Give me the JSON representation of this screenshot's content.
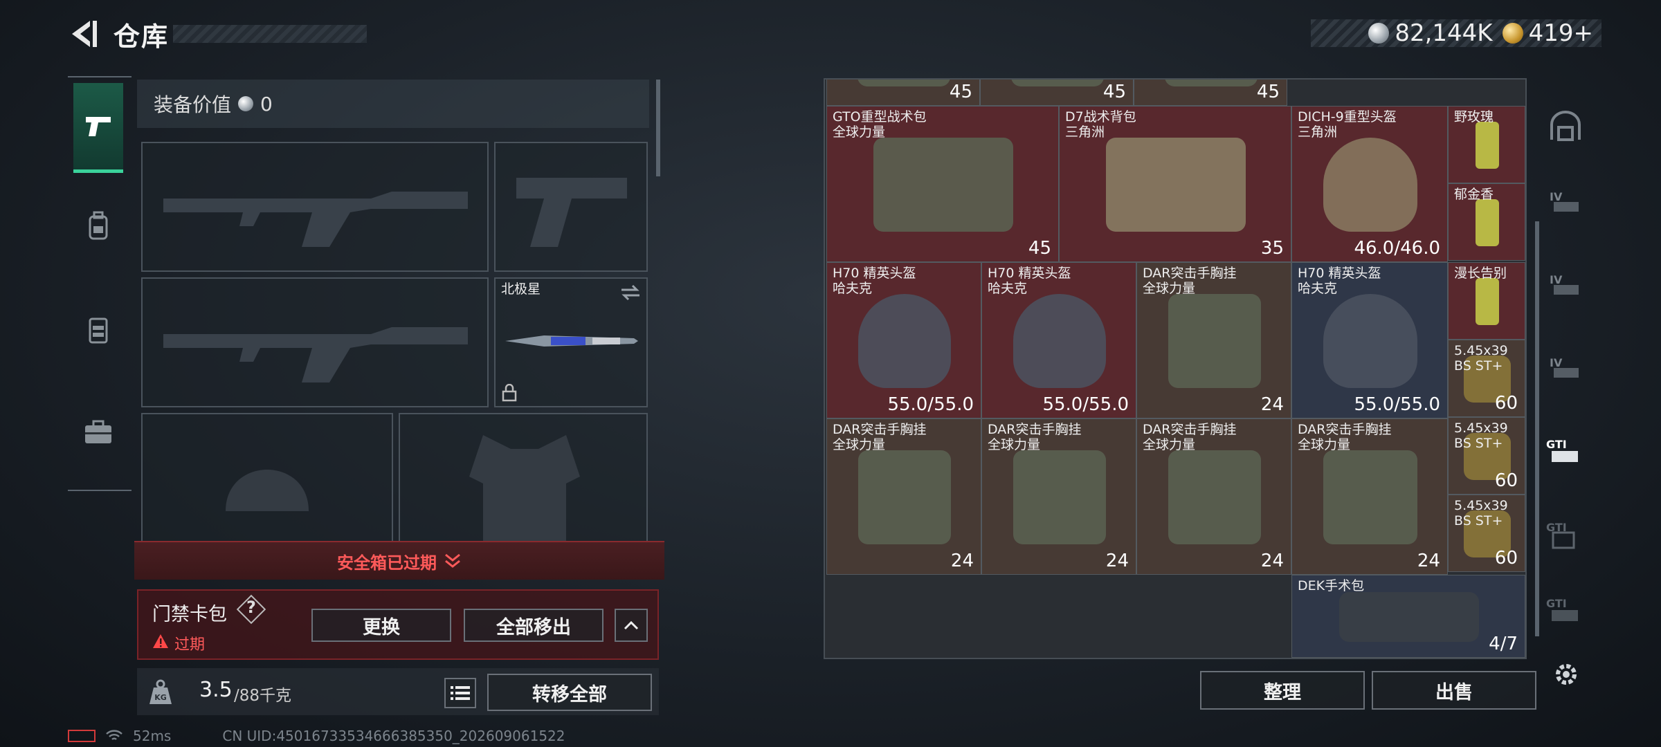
{
  "header": {
    "title": "仓库"
  },
  "currency": {
    "silver": "82,144K",
    "gold": "419+"
  },
  "loadout": {
    "equip_value_label": "装备价值",
    "equip_value": "0",
    "melee_name": "北极星"
  },
  "safebox": {
    "label": "安全箱已过期"
  },
  "keybag": {
    "label": "门禁卡包",
    "help": "?",
    "status": "过期",
    "replace": "更换",
    "remove_all": "全部移出"
  },
  "weight": {
    "value": "3.5",
    "capacity": "/88千克",
    "transfer_all": "转移全部"
  },
  "stash": {
    "items": [
      {
        "name": "",
        "sub": "",
        "count": "45"
      },
      {
        "name": "",
        "sub": "",
        "count": "45"
      },
      {
        "name": "",
        "sub": "",
        "count": "45"
      },
      {
        "name": "GTO重型战术包",
        "sub": "全球力量",
        "count": "45"
      },
      {
        "name": "D7战术背包",
        "sub": "三角洲",
        "count": "35"
      },
      {
        "name": "DICH-9重型头盔",
        "sub": "三角洲",
        "count": "46.0/46.0"
      },
      {
        "name": "野玫瑰",
        "sub": "",
        "count": ""
      },
      {
        "name": "郁金香",
        "sub": "",
        "count": ""
      },
      {
        "name": "H70 精英头盔",
        "sub": "哈夫克",
        "count": "55.0/55.0"
      },
      {
        "name": "漫长告别",
        "sub": "",
        "count": ""
      },
      {
        "name": "H70 精英头盔",
        "sub": "哈夫克",
        "count": "55.0/55.0"
      },
      {
        "name": "H70 精英头盔",
        "sub": "哈夫克",
        "count": "55.0/55.0"
      },
      {
        "name": "DAR突击手胸挂",
        "sub": "全球力量",
        "count": "24"
      },
      {
        "name": "5.45x39",
        "sub": "BS ST+",
        "count": "60"
      },
      {
        "name": "DAR突击手胸挂",
        "sub": "全球力量",
        "count": "24"
      },
      {
        "name": "5.45x39",
        "sub": "BS ST+",
        "count": "60"
      },
      {
        "name": "DAR突击手胸挂",
        "sub": "全球力量",
        "count": "24"
      },
      {
        "name": "DAR突击手胸挂",
        "sub": "全球力量",
        "count": "24"
      },
      {
        "name": "DAR突击手胸挂",
        "sub": "全球力量",
        "count": "24"
      },
      {
        "name": "5.45x39",
        "sub": "BS ST+",
        "count": "60"
      },
      {
        "name": "DEK手术包",
        "sub": "",
        "count": "4/7"
      }
    ]
  },
  "actions": {
    "organize": "整理",
    "sell": "出售"
  },
  "status": {
    "ping": "52ms",
    "uid": "CN UID:45016733534666385350_202609061522"
  },
  "colors": {
    "accent": "#3ad29b",
    "alert": "#ff5a5a"
  }
}
